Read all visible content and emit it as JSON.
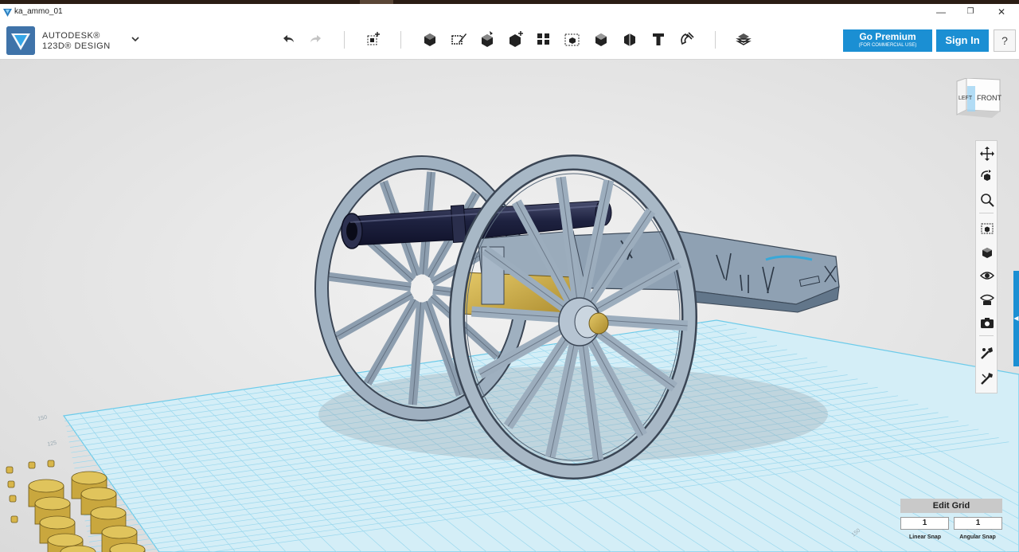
{
  "window": {
    "title": "ka_ammo_01",
    "minimize_glyph": "—",
    "restore_glyph": "❐",
    "close_glyph": "✕"
  },
  "brand": {
    "line1": "AUTODESK®",
    "line2": "123D® DESIGN",
    "menu_glyph": "⌵"
  },
  "toolbar": {
    "icons": [
      "undo-icon",
      "redo-icon",
      "transform-icon",
      "primitives-icon",
      "sketch-icon",
      "construct-icon",
      "modify-icon",
      "pattern-icon",
      "grouping-icon",
      "combine-icon",
      "measure-icon",
      "text-icon",
      "snap-icon",
      "material-icon"
    ]
  },
  "account": {
    "premium_label": "Go Premium",
    "premium_sub": "(FOR COMMERCIAL USE)",
    "signin_label": "Sign In",
    "help_label": "?"
  },
  "viewcube": {
    "left_label": "LEFT",
    "front_label": "FRONT"
  },
  "navbar": {
    "icons": [
      "pan-icon",
      "orbit-icon",
      "zoom-icon",
      "fit-icon",
      "view-icon",
      "visibility-icon",
      "material-view-icon",
      "camera-icon",
      "outliner-icon",
      "settings-icon"
    ]
  },
  "grid_panel": {
    "edit_grid_label": "Edit Grid",
    "linear_snap_value": "1",
    "angular_snap_value": "1",
    "linear_snap_label": "Linear Snap",
    "angular_snap_label": "Angular Snap"
  },
  "grid_labels": [
    "150",
    "125",
    "150"
  ],
  "colors": {
    "accent": "#1b8fd3",
    "grid": "#8fd3ea",
    "barrel": "#1c2038",
    "carriage": "#8fa0b0",
    "brass": "#d2b44c"
  }
}
